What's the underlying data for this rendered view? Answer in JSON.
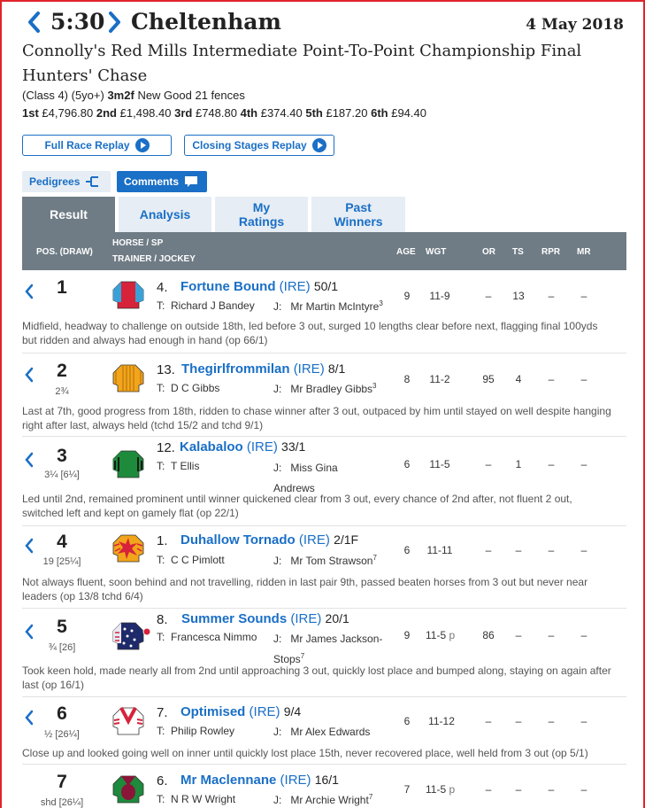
{
  "header": {
    "time": "5:30",
    "course": "Cheltenham",
    "date": "4 May 2018"
  },
  "race": {
    "title": "Connolly's Red Mills Intermediate Point-To-Point Championship Final Hunters' Chase",
    "meta_class": "(Class 4) (5yo+)",
    "meta_dist": "3m2f",
    "meta_rest": "New Good 21 fences",
    "prizes": [
      {
        "place": "1st",
        "amount": "£4,796.80"
      },
      {
        "place": "2nd",
        "amount": "£1,498.40"
      },
      {
        "place": "3rd",
        "amount": "£748.80"
      },
      {
        "place": "4th",
        "amount": "£374.40"
      },
      {
        "place": "5th",
        "amount": "£187.20"
      },
      {
        "place": "6th",
        "amount": "£94.40"
      }
    ]
  },
  "buttons": {
    "full_replay": "Full Race Replay",
    "closing_replay": "Closing Stages Replay",
    "pedigrees": "Pedigrees",
    "comments": "Comments"
  },
  "tabs": [
    {
      "label": "Result",
      "active": true
    },
    {
      "label": "Analysis",
      "active": false
    },
    {
      "label": "My Ratings",
      "active": false
    },
    {
      "label": "Past Winners",
      "active": false
    }
  ],
  "columns": {
    "pos": "POS. (DRAW)",
    "horse": "HORSE / SP",
    "trainer": "TRAINER / JOCKEY",
    "age": "AGE",
    "wgt": "WGT",
    "or": "OR",
    "ts": "TS",
    "rpr": "RPR",
    "mr": "MR"
  },
  "colors": {
    "accent": "#1a6fc6",
    "header_grey": "#6f7c85",
    "tab_bg": "#e6edf4",
    "frame": "#e0242b"
  },
  "runners": [
    {
      "pos": "1",
      "dist": "",
      "num": "4.",
      "name": "Fortune Bound",
      "cty": "(IRE)",
      "sp": "50/1",
      "trainer": "Richard J Bandey",
      "jockey": "Mr Martin McIntyre",
      "jockey_claim": "3",
      "age": "9",
      "wgt": "11-9",
      "or": "–",
      "ts": "13",
      "rpr": "–",
      "mr": "–",
      "comment": "Midfield, headway to challenge on outside 18th, led before 3 out, surged 10 lengths clear before next, flagging final 100yds but ridden and always had enough in hand (op 66/1)",
      "silk": "red-blue-sleeves"
    },
    {
      "pos": "2",
      "dist": "2¾",
      "num": "13.",
      "name": "Thegirlfrommilan",
      "cty": "(IRE)",
      "sp": "8/1",
      "trainer": "D C Gibbs",
      "jockey": "Mr Bradley Gibbs",
      "jockey_claim": "3",
      "age": "8",
      "wgt": "11-2",
      "or": "95",
      "ts": "4",
      "rpr": "–",
      "mr": "–",
      "comment": "Last at 7th, good progress from 18th, ridden to chase winner after 3 out, outpaced by him until stayed on well despite hanging right after last, always held (tchd 15/2 and tchd 9/1)",
      "silk": "orange-stripes"
    },
    {
      "pos": "3",
      "dist": "3¼ [6¼]",
      "num": "12.",
      "name": "Kalabaloo",
      "cty": "(IRE)",
      "sp": "33/1",
      "trainer": "T Ellis",
      "jockey": "Miss Gina Andrews",
      "jockey_claim": "",
      "age": "6",
      "wgt": "11-5",
      "or": "–",
      "ts": "1",
      "rpr": "–",
      "mr": "–",
      "comment": "Led until 2nd, remained prominent until winner quickened clear from 3 out, every chance of 2nd after, not fluent 2 out, switched left and kept on gamely flat (op 22/1)",
      "silk": "green-black"
    },
    {
      "pos": "4",
      "dist": "19 [25¼]",
      "num": "1.",
      "name": "Duhallow Tornado",
      "cty": "(IRE)",
      "sp": "2/1F",
      "trainer": "C C Pimlott",
      "jockey": "Mr Tom Strawson",
      "jockey_claim": "7",
      "age": "6",
      "wgt": "11-11",
      "or": "–",
      "ts": "–",
      "rpr": "–",
      "mr": "–",
      "comment": "Not always fluent, soon behind and not travelling, ridden in last pair 9th, passed beaten horses from 3 out but never near leaders (op 13/8 tchd 6/4)",
      "silk": "orange-star"
    },
    {
      "pos": "5",
      "dist": "¾ [26]",
      "num": "8.",
      "name": "Summer Sounds",
      "cty": "(IRE)",
      "sp": "20/1",
      "trainer": "Francesca Nimmo",
      "jockey": "Mr James Jackson-Stops",
      "jockey_claim": "7",
      "age": "9",
      "wgt": "11-5",
      "wgt_note": "p",
      "or": "86",
      "ts": "–",
      "rpr": "–",
      "mr": "–",
      "comment": "Took keen hold, made nearly all from 2nd until approaching 3 out, quickly lost place and bumped along, staying on again after last (op 16/1)",
      "silk": "navy-stars"
    },
    {
      "pos": "6",
      "dist": "½ [26¼]",
      "num": "7.",
      "name": "Optimised",
      "cty": "(IRE)",
      "sp": "9/4",
      "trainer": "Philip Rowley",
      "jockey": "Mr Alex Edwards",
      "jockey_claim": "",
      "age": "6",
      "wgt": "11-12",
      "or": "–",
      "ts": "–",
      "rpr": "–",
      "mr": "–",
      "comment": "Close up and looked going well on inner until quickly lost place 15th, never recovered place, well held from 3 out (op 5/1)",
      "silk": "white-red-chevron"
    },
    {
      "pos": "7",
      "dist": "shd [26¼]",
      "num": "6.",
      "name": "Mr Maclennane",
      "cty": "(IRE)",
      "sp": "16/1",
      "trainer": "N R W Wright",
      "jockey": "Mr Archie Wright",
      "jockey_claim": "7",
      "age": "7",
      "wgt": "11-5",
      "wgt_note": "p",
      "or": "–",
      "ts": "–",
      "rpr": "–",
      "mr": "–",
      "comment": "",
      "silk": "green-maroon"
    }
  ]
}
